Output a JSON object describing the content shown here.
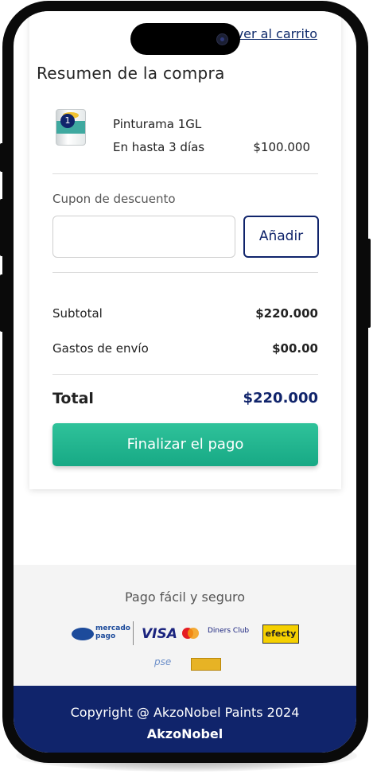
{
  "header": {
    "back_link": "ver al carrito"
  },
  "summary": {
    "title": "Resumen de la compra",
    "item": {
      "quantity": "1",
      "name": "Pinturama 1GL",
      "delivery": "En hasta 3 días",
      "price": "$100.000"
    },
    "coupon": {
      "label": "Cupon de descuento",
      "placeholder": "",
      "value": "",
      "add_label": "Añadir"
    },
    "subtotal": {
      "label": "Subtotal",
      "value": "$220.000"
    },
    "shipping": {
      "label": "Gastos de envío",
      "value": "$00.00"
    },
    "total": {
      "label": "Total",
      "value": "$220.000"
    },
    "checkout_label": "Finalizar el pago"
  },
  "payment": {
    "title": "Pago fácil y seguro",
    "methods": [
      "mercado pago",
      "VISA",
      "mastercard",
      "Diners Club International",
      "efecty",
      "pse",
      "tarjeta"
    ],
    "mp_text": "mercado pago",
    "visa_text": "VISA",
    "diners_text": "Diners Club",
    "efecty_text": "efecty",
    "pse_text": "pse"
  },
  "footer": {
    "copyright": "Copyright @ AkzoNobel Paints 2024",
    "brand": "AkzoNobel"
  },
  "colors": {
    "primary": "#10246b",
    "accent": "#1fb38e",
    "footer": "#10246b"
  }
}
